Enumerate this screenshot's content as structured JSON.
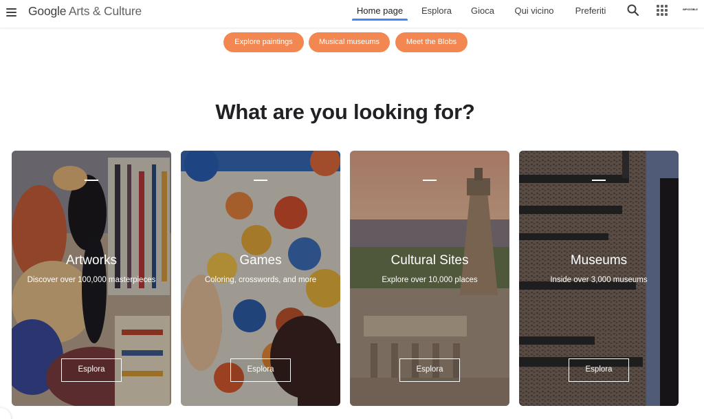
{
  "header": {
    "logo_google": "Google",
    "logo_rest": " Arts & Culture",
    "nav": [
      {
        "label": "Home page",
        "active": true
      },
      {
        "label": "Esplora",
        "active": false
      },
      {
        "label": "Gioca",
        "active": false
      },
      {
        "label": "Qui vicino",
        "active": false
      },
      {
        "label": "Preferiti",
        "active": false
      }
    ],
    "account_text": "IMPOSSIBLE",
    "icons": [
      "menu-icon",
      "search-icon",
      "apps-icon"
    ]
  },
  "chips": [
    "Explore paintings",
    "Musical museums",
    "Meet the Blobs"
  ],
  "accent_color": "#f28752",
  "active_tab_color": "#4285f4",
  "heading": "What are you looking for?",
  "cards": [
    {
      "title": "Artworks",
      "subtitle": "Discover over 100,000 masterpieces",
      "button": "Esplora"
    },
    {
      "title": "Games",
      "subtitle": "Coloring, crosswords, and more",
      "button": "Esplora"
    },
    {
      "title": "Cultural Sites",
      "subtitle": "Explore over 10,000 places",
      "button": "Esplora"
    },
    {
      "title": "Museums",
      "subtitle": "Inside over 3,000 museums",
      "button": "Esplora"
    }
  ]
}
